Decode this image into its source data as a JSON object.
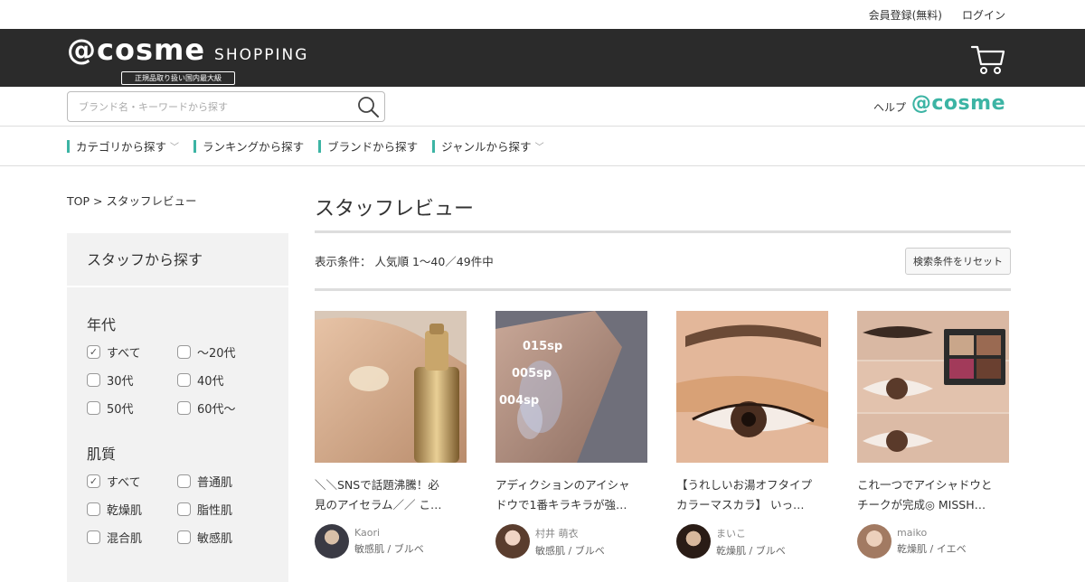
{
  "util": {
    "register": "会員登録(無料)",
    "login": "ログイン"
  },
  "header": {
    "logo_main": "@cosme",
    "logo_sub": "SHOPPING",
    "logo_tag": "正規品取り扱い国内最大級"
  },
  "search": {
    "placeholder": "ブランド名・キーワードから探す"
  },
  "links": {
    "help": "ヘルプ",
    "cosme": "@cosme"
  },
  "nav": [
    {
      "label": "カテゴリから探す",
      "dropdown": true
    },
    {
      "label": "ランキングから探す",
      "dropdown": false
    },
    {
      "label": "ブランドから探す",
      "dropdown": false
    },
    {
      "label": "ジャンルから探す",
      "dropdown": true
    }
  ],
  "breadcrumb": {
    "top": "TOP",
    "sep": ">",
    "current": "スタッフレビュー"
  },
  "sidebar": {
    "title": "スタッフから探す",
    "age": {
      "title": "年代",
      "options": [
        {
          "label": "すべて",
          "checked": true
        },
        {
          "label": "～20代",
          "checked": false
        },
        {
          "label": "30代",
          "checked": false
        },
        {
          "label": "40代",
          "checked": false
        },
        {
          "label": "50代",
          "checked": false
        },
        {
          "label": "60代～",
          "checked": false
        }
      ]
    },
    "skin": {
      "title": "肌質",
      "options": [
        {
          "label": "すべて",
          "checked": true
        },
        {
          "label": "普通肌",
          "checked": false
        },
        {
          "label": "乾燥肌",
          "checked": false
        },
        {
          "label": "脂性肌",
          "checked": false
        },
        {
          "label": "混合肌",
          "checked": false
        },
        {
          "label": "敏感肌",
          "checked": false
        }
      ]
    }
  },
  "main": {
    "title": "スタッフレビュー",
    "condition": "表示条件： 人気順 1～40／49件中",
    "reset_label": "検索条件をリセット",
    "cards": [
      {
        "title1": "＼＼SNSで話題沸騰！必",
        "title2": "見のアイセラム／／ こ…",
        "user": "Kaori",
        "skin": "敏感肌 / ブルベ"
      },
      {
        "title1": "アディクションのアイシャ",
        "title2": "ドウで1番キラキラが強…",
        "user": "村井 萌衣",
        "skin": "敏感肌 / ブルベ",
        "swatches": [
          "015sp",
          "005sp",
          "004sp"
        ]
      },
      {
        "title1": "【うれしいお湯オフタイプ",
        "title2": "カラーマスカラ】 いっ…",
        "user": "まいこ",
        "skin": "乾燥肌 / ブルベ"
      },
      {
        "title1": "これ一つでアイシャドウと",
        "title2": "チークが完成◎ MISSH…",
        "user": "maiko",
        "skin": "乾燥肌 / イエベ"
      }
    ]
  },
  "colors": {
    "accent": "#3cb4a4",
    "header_bg": "#2b2b2b",
    "sidebar_bg": "#f2f2f2"
  }
}
